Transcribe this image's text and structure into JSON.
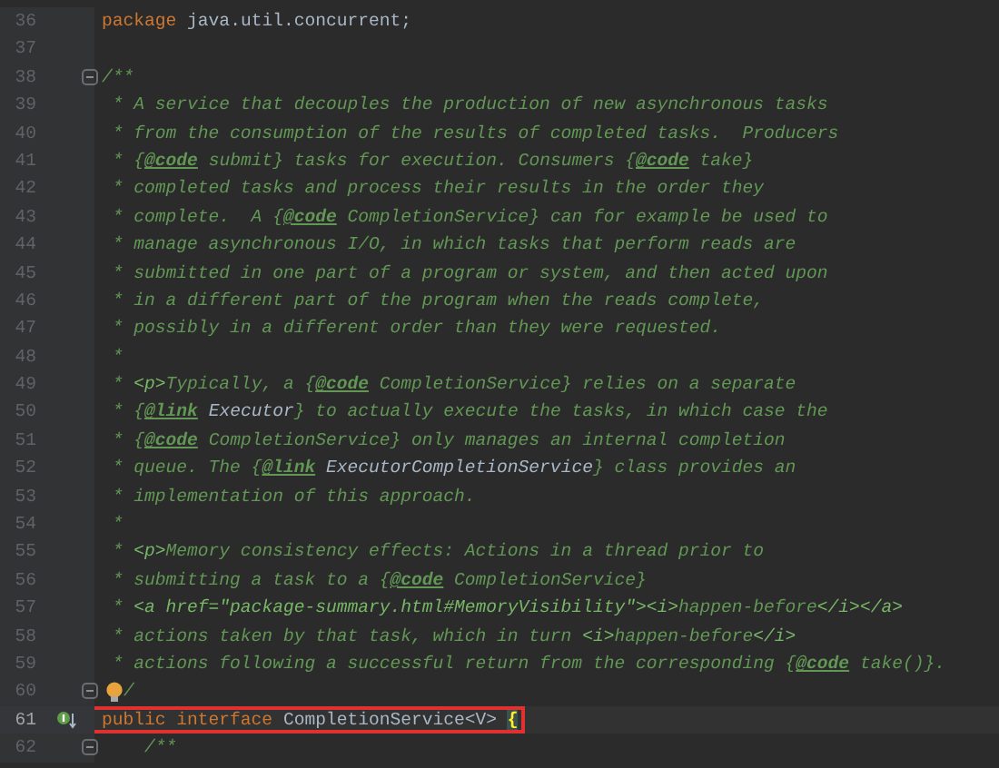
{
  "editor": {
    "lines": [
      {
        "number": "36",
        "segments": [
          {
            "kind": "keyword",
            "text": "package "
          },
          {
            "kind": "plain",
            "text": "java.util.concurrent;"
          }
        ]
      },
      {
        "number": "37"
      },
      {
        "number": "38",
        "gutter_icons": [
          {
            "kind": "fold"
          }
        ],
        "segments": [
          {
            "kind": "doc",
            "text": "/**"
          }
        ]
      },
      {
        "number": "39",
        "segments": [
          {
            "kind": "doc",
            "text": " * A service that decouples the production of new asynchronous tasks"
          }
        ]
      },
      {
        "number": "40",
        "segments": [
          {
            "kind": "doc",
            "text": " * from the consumption of the results of completed tasks.  Producers"
          }
        ]
      },
      {
        "number": "41",
        "segments": [
          {
            "kind": "doc",
            "text": " * {"
          },
          {
            "kind": "doctag",
            "text": "@code"
          },
          {
            "kind": "doc",
            "text": " submit} tasks for execution. Consumers {"
          },
          {
            "kind": "doctag",
            "text": "@code"
          },
          {
            "kind": "doc",
            "text": " take}"
          }
        ]
      },
      {
        "number": "42",
        "segments": [
          {
            "kind": "doc",
            "text": " * completed tasks and process their results in the order they"
          }
        ]
      },
      {
        "number": "43",
        "segments": [
          {
            "kind": "doc",
            "text": " * complete.  A {"
          },
          {
            "kind": "doctag",
            "text": "@code"
          },
          {
            "kind": "doc",
            "text": " CompletionService} can for example be used to"
          }
        ]
      },
      {
        "number": "44",
        "segments": [
          {
            "kind": "doc",
            "text": " * manage asynchronous I/O, in which tasks that perform reads are"
          }
        ]
      },
      {
        "number": "45",
        "segments": [
          {
            "kind": "doc",
            "text": " * submitted in one part of a program or system, and then acted upon"
          }
        ]
      },
      {
        "number": "46",
        "segments": [
          {
            "kind": "doc",
            "text": " * in a different part of the program when the reads complete,"
          }
        ]
      },
      {
        "number": "47",
        "segments": [
          {
            "kind": "doc",
            "text": " * possibly in a different order than they were requested."
          }
        ]
      },
      {
        "number": "48",
        "segments": [
          {
            "kind": "doc",
            "text": " *"
          }
        ]
      },
      {
        "number": "49",
        "segments": [
          {
            "kind": "doc",
            "text": " * "
          },
          {
            "kind": "html",
            "text": "<p>"
          },
          {
            "kind": "doc",
            "text": "Typically, a {"
          },
          {
            "kind": "doctag",
            "text": "@code"
          },
          {
            "kind": "doc",
            "text": " CompletionService} relies on a separate"
          }
        ]
      },
      {
        "number": "50",
        "segments": [
          {
            "kind": "doc",
            "text": " * {"
          },
          {
            "kind": "doctag",
            "text": "@link"
          },
          {
            "kind": "docref",
            "text": " Executor"
          },
          {
            "kind": "doc",
            "text": "} to actually execute the tasks, in which case the"
          }
        ]
      },
      {
        "number": "51",
        "segments": [
          {
            "kind": "doc",
            "text": " * {"
          },
          {
            "kind": "doctag",
            "text": "@code"
          },
          {
            "kind": "doc",
            "text": " CompletionService} only manages an internal completion"
          }
        ]
      },
      {
        "number": "52",
        "segments": [
          {
            "kind": "doc",
            "text": " * queue. The {"
          },
          {
            "kind": "doctag",
            "text": "@link"
          },
          {
            "kind": "docref",
            "text": " ExecutorCompletionService"
          },
          {
            "kind": "doc",
            "text": "} class provides an"
          }
        ]
      },
      {
        "number": "53",
        "segments": [
          {
            "kind": "doc",
            "text": " * implementation of this approach."
          }
        ]
      },
      {
        "number": "54",
        "segments": [
          {
            "kind": "doc",
            "text": " *"
          }
        ]
      },
      {
        "number": "55",
        "segments": [
          {
            "kind": "doc",
            "text": " * "
          },
          {
            "kind": "html",
            "text": "<p>"
          },
          {
            "kind": "doc",
            "text": "Memory consistency effects: Actions in a thread prior to"
          }
        ]
      },
      {
        "number": "56",
        "segments": [
          {
            "kind": "doc",
            "text": " * submitting a task to a {"
          },
          {
            "kind": "doctag",
            "text": "@code"
          },
          {
            "kind": "doc",
            "text": " CompletionService}"
          }
        ]
      },
      {
        "number": "57",
        "segments": [
          {
            "kind": "doc",
            "text": " * "
          },
          {
            "kind": "html",
            "text": "<a href=\"package-summary.html#MemoryVisibility\"><i>"
          },
          {
            "kind": "doc",
            "text": "happen-before"
          },
          {
            "kind": "html",
            "text": "</i></a>"
          }
        ]
      },
      {
        "number": "58",
        "segments": [
          {
            "kind": "doc",
            "text": " * actions taken by that task, which in turn "
          },
          {
            "kind": "html",
            "text": "<i>"
          },
          {
            "kind": "doc",
            "text": "happen-before"
          },
          {
            "kind": "html",
            "text": "</i>"
          }
        ]
      },
      {
        "number": "59",
        "segments": [
          {
            "kind": "doc",
            "text": " * actions following a successful return from the corresponding {"
          },
          {
            "kind": "doctag",
            "text": "@code"
          },
          {
            "kind": "doc",
            "text": " take()}."
          }
        ]
      },
      {
        "number": "60",
        "gutter_icons": [
          {
            "kind": "fold"
          },
          {
            "kind": "bulb"
          }
        ],
        "segments": [
          {
            "kind": "doc",
            "text": "/"
          }
        ]
      },
      {
        "number": "61",
        "current": true,
        "annotated": true,
        "gutter_icons": [
          {
            "kind": "implemented"
          }
        ],
        "segments": [
          {
            "kind": "keyword",
            "text": "public interface "
          },
          {
            "kind": "plain",
            "text": "CompletionService<V> "
          },
          {
            "kind": "brace_match",
            "text": "{"
          }
        ]
      },
      {
        "number": "62",
        "gutter_icons": [
          {
            "kind": "fold"
          }
        ],
        "segments": [
          {
            "kind": "doc",
            "text": "    /**"
          }
        ]
      }
    ]
  }
}
